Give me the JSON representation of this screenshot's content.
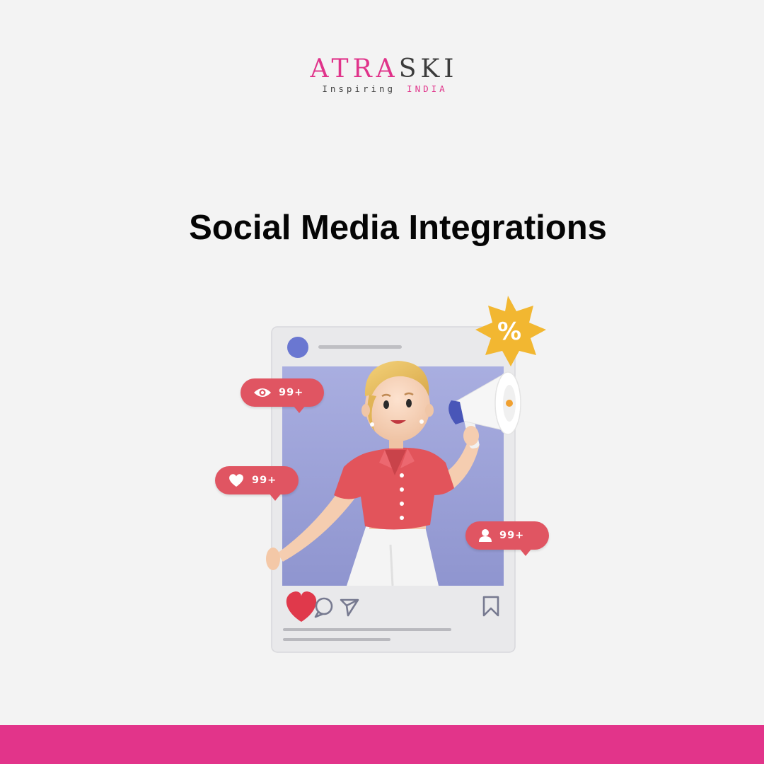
{
  "logo": {
    "word_part1": "ATRA",
    "word_part2": "SKI",
    "tagline_part1": "Inspiring",
    "tagline_part2": "INDIA",
    "colors": {
      "pink": "#e0338a",
      "dark": "#3c3c3c"
    }
  },
  "title": "Social Media Integrations",
  "post": {
    "badges": [
      {
        "icon": "eye-icon",
        "count": "99+"
      },
      {
        "icon": "heart-icon",
        "count": "99+"
      },
      {
        "icon": "user-icon",
        "count": "99+"
      }
    ],
    "discount_symbol": "%",
    "action_icons": [
      "heart-icon",
      "comment-icon",
      "send-icon",
      "bookmark-icon"
    ]
  },
  "colors": {
    "background": "#f3f3f3",
    "accent_pink": "#e2348a",
    "badge_red": "#e05562",
    "photo_bg": "#9ea3d8",
    "avatar_blue": "#6a77d1",
    "star_yellow": "#f2b731"
  }
}
